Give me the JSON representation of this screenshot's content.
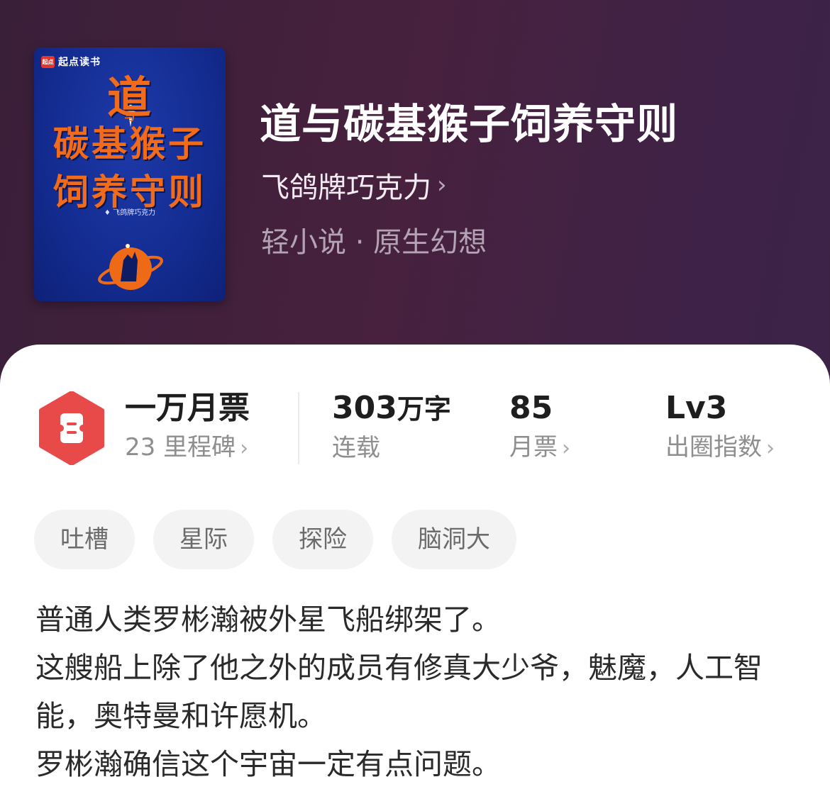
{
  "cover": {
    "brand_logo": "起点",
    "brand_name": "起点读书",
    "title_line1": "道",
    "title_line2": "与",
    "title_line3": "碳基猴子",
    "title_line4": "饲养守则",
    "author": "飞鸽牌巧克力",
    "colors": {
      "background": "#142d93",
      "title": "#f26b1a"
    }
  },
  "book": {
    "title": "道与碳基猴子饲养守则",
    "author": "飞鸽牌巧克力",
    "category": "轻小说 · 原生幻想"
  },
  "stats": {
    "ticket": {
      "value": "一万月票",
      "label": "23 里程碑"
    },
    "words": {
      "value": "303",
      "unit": "万字",
      "label": "连载"
    },
    "monthly": {
      "value": "85",
      "label": "月票"
    },
    "level": {
      "value": "Lv3",
      "label": "出圈指数"
    }
  },
  "tags": [
    "吐槽",
    "星际",
    "探险",
    "脑洞大"
  ],
  "intro": [
    "普通人类罗彬瀚被外星飞船绑架了。",
    "这艘船上除了他之外的成员有修真大少爷，魅魔，人工智能，奥特曼和许愿机。",
    "罗彬瀚确信这个宇宙一定有点问题。"
  ],
  "icons": {
    "chevron": "chevron-right-icon",
    "medal": "ticket-medal-icon"
  },
  "colors": {
    "header_bg": "#44213f",
    "medal": "#e84a4a",
    "card_bg": "#ffffff",
    "tag_bg": "#f3f3f3"
  }
}
